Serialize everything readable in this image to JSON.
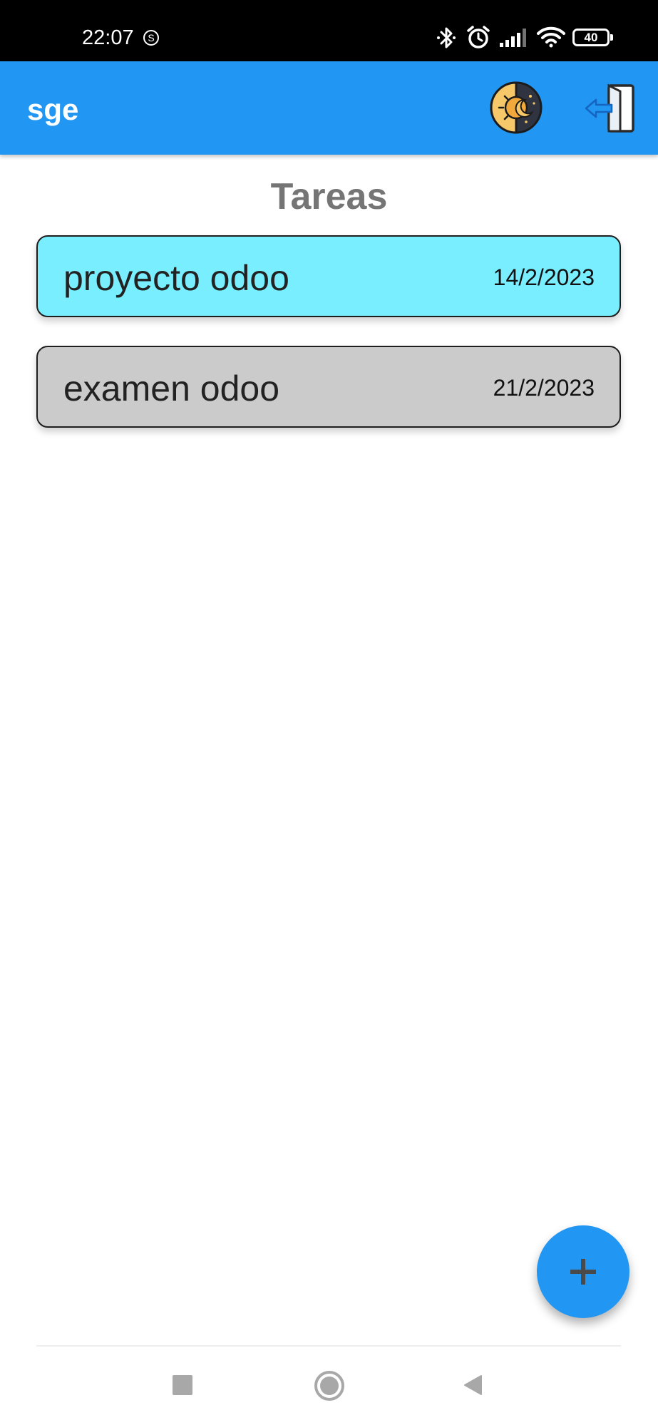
{
  "status_bar": {
    "time": "22:07",
    "sync_icon_letter": "S",
    "battery_level": "40",
    "icons": [
      "sync-icon",
      "bluetooth-icon",
      "alarm-icon",
      "signal-icon",
      "wifi-icon",
      "battery-icon"
    ]
  },
  "app_bar": {
    "title": "sge",
    "theme_toggle_icon": "day-night-icon",
    "logout_icon": "logout-door-icon",
    "background_color": "#2196f3"
  },
  "page": {
    "title": "Tareas"
  },
  "tasks": [
    {
      "name": "proyecto odoo",
      "date": "14/2/2023",
      "color": "#78eefe"
    },
    {
      "name": "examen odoo",
      "date": "21/2/2023",
      "color": "#cbcbcb"
    }
  ],
  "fab": {
    "label": "+",
    "icon": "plus-icon",
    "color": "#2196f3"
  },
  "nav_bar": {
    "buttons": [
      "recents-square-icon",
      "home-circle-icon",
      "back-triangle-icon"
    ]
  }
}
